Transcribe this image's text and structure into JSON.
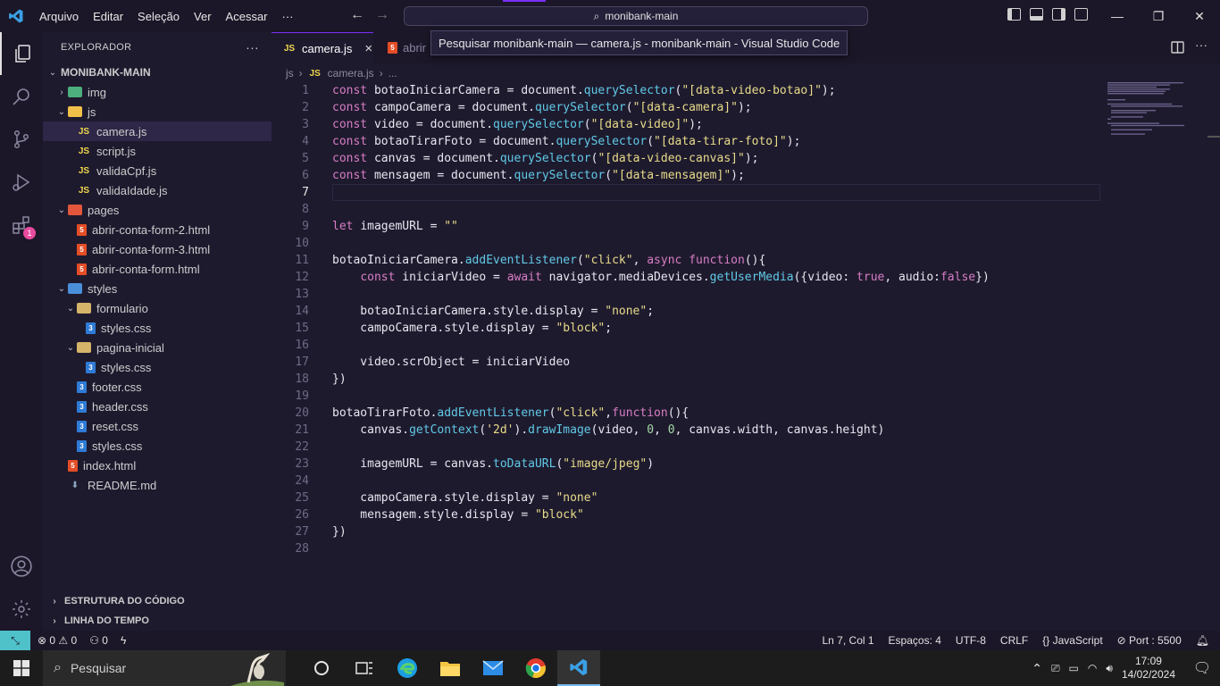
{
  "titlebar": {
    "menu": [
      "Arquivo",
      "Editar",
      "Seleção",
      "Ver",
      "Acessar",
      "···"
    ],
    "search_text": "monibank-main"
  },
  "tooltip": "Pesquisar monibank-main — camera.js - monibank-main - Visual Studio Code",
  "activity": {
    "extensions_badge": "1"
  },
  "sidebar": {
    "title": "EXPLORADOR",
    "more": "···",
    "root": "MONIBANK-MAIN",
    "items": [
      {
        "label": "img",
        "type": "folder",
        "depth": 1,
        "expanded": false
      },
      {
        "label": "js",
        "type": "folder",
        "depth": 1,
        "expanded": true
      },
      {
        "label": "camera.js",
        "type": "js",
        "depth": 2,
        "selected": true
      },
      {
        "label": "script.js",
        "type": "js",
        "depth": 2
      },
      {
        "label": "validaCpf.js",
        "type": "js",
        "depth": 2
      },
      {
        "label": "validaIdade.js",
        "type": "js",
        "depth": 2
      },
      {
        "label": "pages",
        "type": "folder",
        "depth": 1,
        "expanded": true
      },
      {
        "label": "abrir-conta-form-2.html",
        "type": "html",
        "depth": 2
      },
      {
        "label": "abrir-conta-form-3.html",
        "type": "html",
        "depth": 2
      },
      {
        "label": "abrir-conta-form.html",
        "type": "html",
        "depth": 2
      },
      {
        "label": "styles",
        "type": "folder",
        "depth": 1,
        "expanded": true
      },
      {
        "label": "formulario",
        "type": "folder",
        "depth": 2,
        "expanded": true
      },
      {
        "label": "styles.css",
        "type": "css",
        "depth": 3
      },
      {
        "label": "pagina-inicial",
        "type": "folder",
        "depth": 2,
        "expanded": true
      },
      {
        "label": "styles.css",
        "type": "css",
        "depth": 3
      },
      {
        "label": "footer.css",
        "type": "css",
        "depth": 2
      },
      {
        "label": "header.css",
        "type": "css",
        "depth": 2
      },
      {
        "label": "reset.css",
        "type": "css",
        "depth": 2
      },
      {
        "label": "styles.css",
        "type": "css",
        "depth": 2
      },
      {
        "label": "index.html",
        "type": "html",
        "depth": 1
      },
      {
        "label": "README.md",
        "type": "md",
        "depth": 1
      }
    ],
    "sections": [
      "ESTRUTURA DO CÓDIGO",
      "LINHA DO TEMPO"
    ]
  },
  "tabs": {
    "active_label": "camera.js",
    "active_icon": "JS",
    "close": "×",
    "second_label": "abrir"
  },
  "breadcrumb": {
    "folder": "js",
    "icon": "JS",
    "file": "camera.js",
    "more": "..."
  },
  "code_lines": [
    [
      [
        "const ",
        "kw"
      ],
      [
        "botaoIniciarCamera = document.",
        ""
      ],
      [
        "querySelector",
        "fn"
      ],
      [
        "(",
        ""
      ],
      [
        "\"[data-video-botao]\"",
        "str"
      ],
      [
        ");",
        ""
      ]
    ],
    [
      [
        "const ",
        "kw"
      ],
      [
        "campoCamera = document.",
        ""
      ],
      [
        "querySelector",
        "fn"
      ],
      [
        "(",
        ""
      ],
      [
        "\"[data-camera]\"",
        "str"
      ],
      [
        ");",
        ""
      ]
    ],
    [
      [
        "const ",
        "kw"
      ],
      [
        "video = document.",
        ""
      ],
      [
        "querySelector",
        "fn"
      ],
      [
        "(",
        ""
      ],
      [
        "\"[data-video]\"",
        "str"
      ],
      [
        ");",
        ""
      ]
    ],
    [
      [
        "const ",
        "kw"
      ],
      [
        "botaoTirarFoto = document.",
        ""
      ],
      [
        "querySelector",
        "fn"
      ],
      [
        "(",
        ""
      ],
      [
        "\"[data-tirar-foto]\"",
        "str"
      ],
      [
        ");",
        ""
      ]
    ],
    [
      [
        "const ",
        "kw"
      ],
      [
        "canvas = document.",
        ""
      ],
      [
        "querySelector",
        "fn"
      ],
      [
        "(",
        ""
      ],
      [
        "\"[data-video-canvas]\"",
        "str"
      ],
      [
        ");",
        ""
      ]
    ],
    [
      [
        "const ",
        "kw"
      ],
      [
        "mensagem = document.",
        ""
      ],
      [
        "querySelector",
        "fn"
      ],
      [
        "(",
        ""
      ],
      [
        "\"[data-mensagem]\"",
        "str"
      ],
      [
        ");",
        ""
      ]
    ],
    [],
    [],
    [
      [
        "let ",
        "kw"
      ],
      [
        "imagemURL = ",
        ""
      ],
      [
        "\"\"",
        "str"
      ]
    ],
    [],
    [
      [
        "botaoIniciarCamera.",
        ""
      ],
      [
        "addEventListener",
        "fn"
      ],
      [
        "(",
        ""
      ],
      [
        "\"click\"",
        "str"
      ],
      [
        ", ",
        ""
      ],
      [
        "async ",
        "kw"
      ],
      [
        "function",
        "kw"
      ],
      [
        "(){",
        ""
      ]
    ],
    [
      [
        "    ",
        ""
      ],
      [
        "const ",
        "kw"
      ],
      [
        "iniciarVideo = ",
        ""
      ],
      [
        "await ",
        "kw"
      ],
      [
        "navigator.mediaDevices.",
        ""
      ],
      [
        "getUserMedia",
        "fn"
      ],
      [
        "({video: ",
        ""
      ],
      [
        "true",
        "bool"
      ],
      [
        ", audio:",
        ""
      ],
      [
        "false",
        "bool"
      ],
      [
        "})",
        ""
      ]
    ],
    [],
    [
      [
        "    botaoIniciarCamera.style.display = ",
        ""
      ],
      [
        "\"none\"",
        "str"
      ],
      [
        ";",
        ""
      ]
    ],
    [
      [
        "    campoCamera.style.display = ",
        ""
      ],
      [
        "\"block\"",
        "str"
      ],
      [
        ";",
        ""
      ]
    ],
    [],
    [
      [
        "    video.scrObject = iniciarVideo",
        ""
      ]
    ],
    [
      [
        "})",
        ""
      ]
    ],
    [],
    [
      [
        "botaoTirarFoto.",
        ""
      ],
      [
        "addEventListener",
        "fn"
      ],
      [
        "(",
        ""
      ],
      [
        "\"click\"",
        "str"
      ],
      [
        ",",
        ""
      ],
      [
        "function",
        "kw"
      ],
      [
        "(){",
        ""
      ]
    ],
    [
      [
        "    canvas.",
        ""
      ],
      [
        "getContext",
        "fn"
      ],
      [
        "(",
        ""
      ],
      [
        "'2d'",
        "str"
      ],
      [
        ").",
        ""
      ],
      [
        "drawImage",
        "fn"
      ],
      [
        "(video, ",
        ""
      ],
      [
        "0",
        "num"
      ],
      [
        ", ",
        ""
      ],
      [
        "0",
        "num"
      ],
      [
        ", canvas.width, canvas.height)",
        ""
      ]
    ],
    [],
    [
      [
        "    imagemURL = canvas.",
        ""
      ],
      [
        "toDataURL",
        "fn"
      ],
      [
        "(",
        ""
      ],
      [
        "\"image/jpeg\"",
        "str"
      ],
      [
        ")",
        ""
      ]
    ],
    [],
    [
      [
        "    campoCamera.style.display = ",
        ""
      ],
      [
        "\"none\"",
        "str"
      ]
    ],
    [
      [
        "    mensagem.style.display = ",
        ""
      ],
      [
        "\"block\"",
        "str"
      ]
    ],
    [
      [
        "})",
        ""
      ]
    ],
    []
  ],
  "current_line": 7,
  "status": {
    "errors": "0",
    "warnings": "0",
    "ports": "0",
    "position": "Ln 7, Col 1",
    "spaces": "Espaços: 4",
    "encoding": "UTF-8",
    "eol": "CRLF",
    "language": "JavaScript",
    "port": "Port : 5500"
  },
  "taskbar": {
    "search_placeholder": "Pesquisar",
    "time": "17:09",
    "date": "14/02/2024"
  },
  "colors": {
    "accent": "#7b2ff7",
    "keyword": "#d77dc4",
    "function": "#60c9e6",
    "string": "#e8dc8a",
    "number": "#a3d9a5"
  }
}
